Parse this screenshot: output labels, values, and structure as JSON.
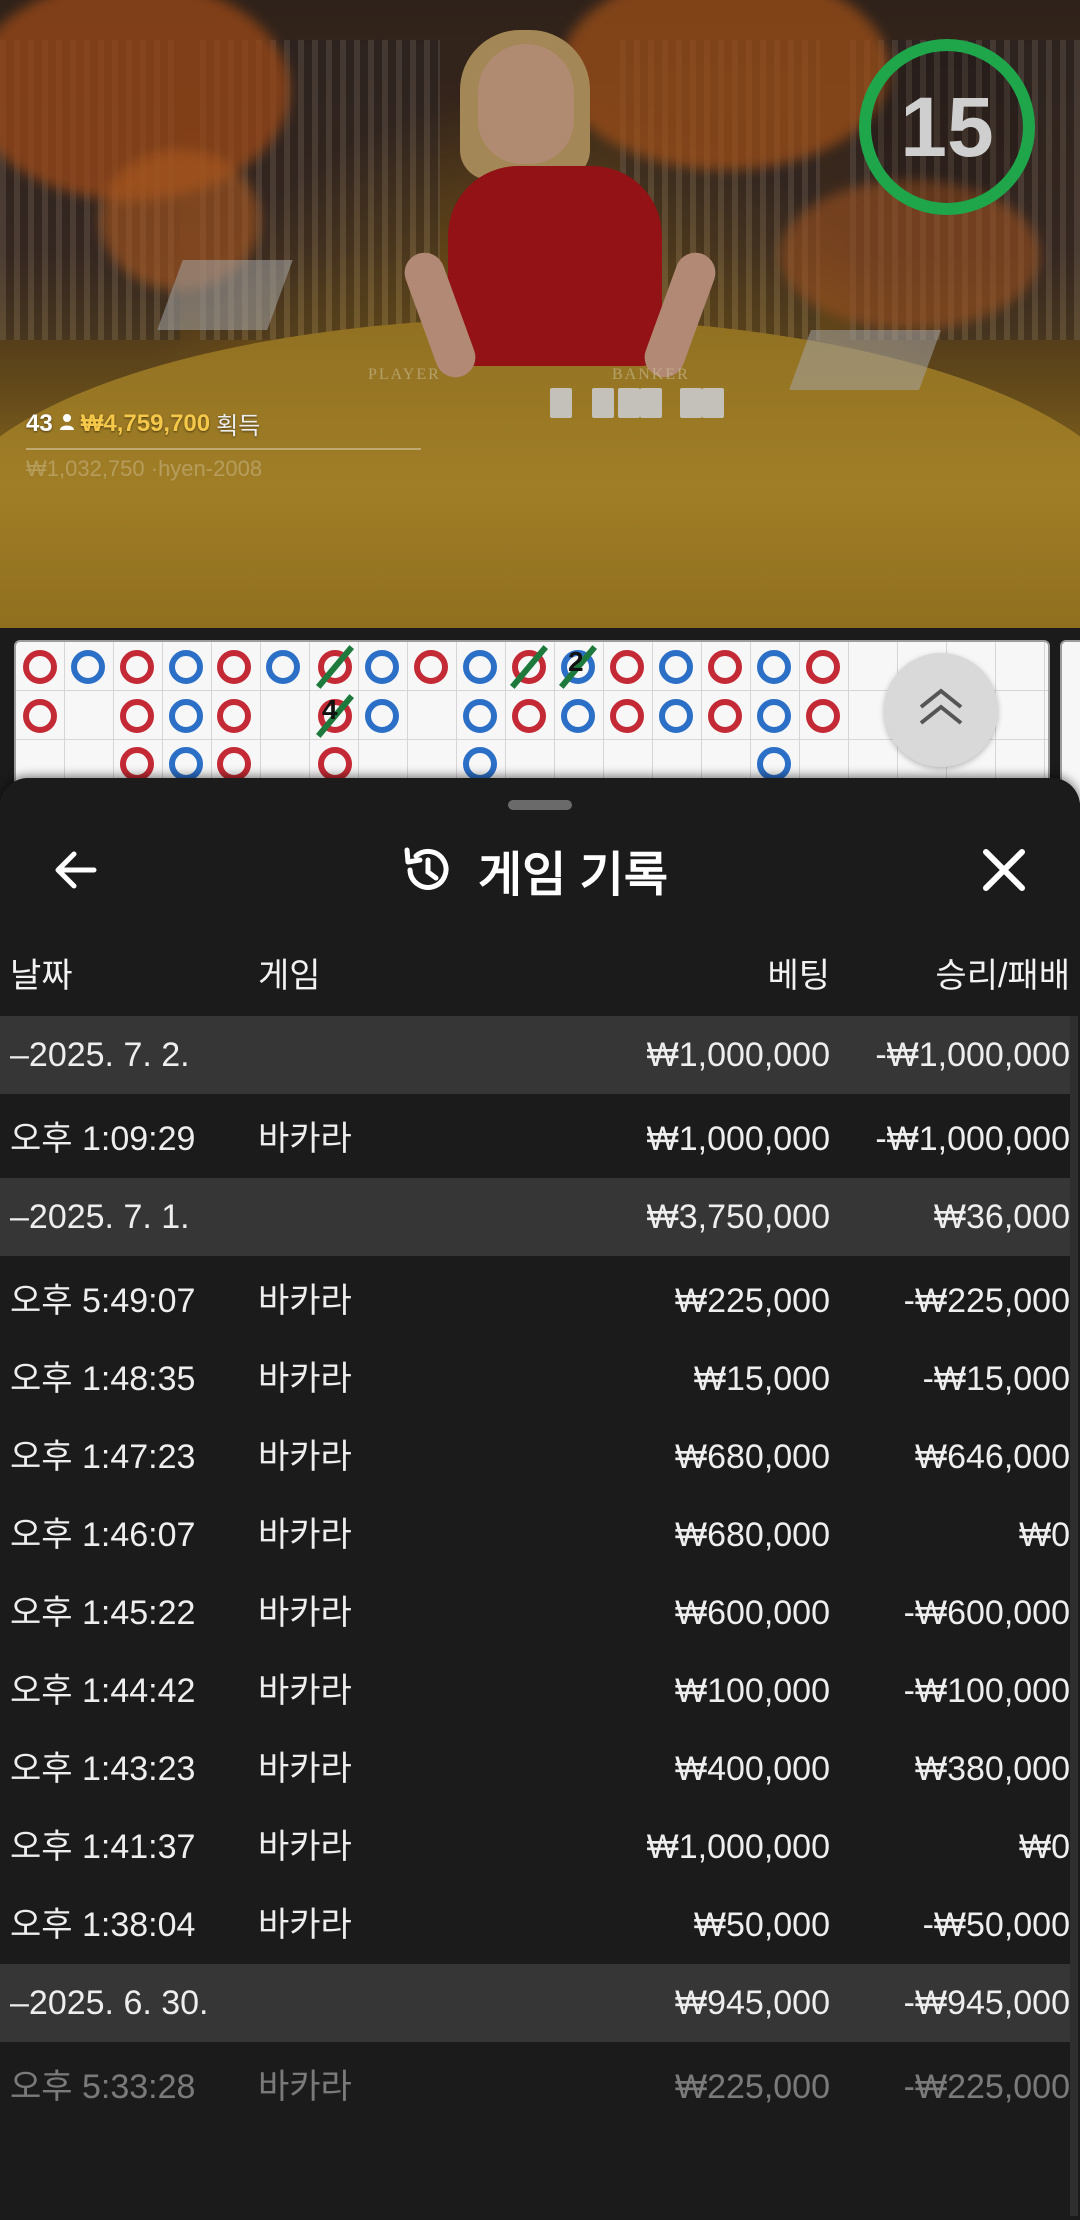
{
  "video": {
    "winners_count": "43",
    "winners_amount": "₩4,759,700",
    "winners_suffix": "획득",
    "ticker_text": "₩1,032,750 ·hyen-2008",
    "table_label_player": "PLAYER",
    "table_label_banker": "BANKER",
    "timer": "15",
    "timer_color": "#1fa64b"
  },
  "roadmap": {
    "numbers": [
      "2",
      "4"
    ]
  },
  "sheet": {
    "title": "게임 기록",
    "back_icon": "arrow-left-icon",
    "history_icon": "history-clock-icon",
    "close_icon": "close-icon",
    "columns": {
      "date": "날짜",
      "game": "게임",
      "bet": "베팅",
      "result": "승리/패배"
    },
    "rows": [
      {
        "type": "date",
        "label": "–2025. 7. 2.",
        "game": "",
        "bet": "₩1,000,000",
        "result": "-₩1,000,000"
      },
      {
        "type": "game",
        "label": "오후 1:09:29",
        "game": "바카라",
        "bet": "₩1,000,000",
        "result": "-₩1,000,000"
      },
      {
        "type": "date",
        "label": "–2025. 7. 1.",
        "game": "",
        "bet": "₩3,750,000",
        "result": "₩36,000"
      },
      {
        "type": "game",
        "label": "오후 5:49:07",
        "game": "바카라",
        "bet": "₩225,000",
        "result": "-₩225,000"
      },
      {
        "type": "game",
        "label": "오후 1:48:35",
        "game": "바카라",
        "bet": "₩15,000",
        "result": "-₩15,000"
      },
      {
        "type": "game",
        "label": "오후 1:47:23",
        "game": "바카라",
        "bet": "₩680,000",
        "result": "₩646,000"
      },
      {
        "type": "game",
        "label": "오후 1:46:07",
        "game": "바카라",
        "bet": "₩680,000",
        "result": "₩0"
      },
      {
        "type": "game",
        "label": "오후 1:45:22",
        "game": "바카라",
        "bet": "₩600,000",
        "result": "-₩600,000"
      },
      {
        "type": "game",
        "label": "오후 1:44:42",
        "game": "바카라",
        "bet": "₩100,000",
        "result": "-₩100,000"
      },
      {
        "type": "game",
        "label": "오후 1:43:23",
        "game": "바카라",
        "bet": "₩400,000",
        "result": "₩380,000"
      },
      {
        "type": "game",
        "label": "오후 1:41:37",
        "game": "바카라",
        "bet": "₩1,000,000",
        "result": "₩0"
      },
      {
        "type": "game",
        "label": "오후 1:38:04",
        "game": "바카라",
        "bet": "₩50,000",
        "result": "-₩50,000"
      },
      {
        "type": "date",
        "label": "–2025. 6. 30.",
        "game": "",
        "bet": "₩945,000",
        "result": "-₩945,000"
      },
      {
        "type": "game",
        "label": "오후 5:33:28",
        "game": "바카라",
        "bet": "₩225,000",
        "result": "-₩225,000"
      }
    ]
  }
}
